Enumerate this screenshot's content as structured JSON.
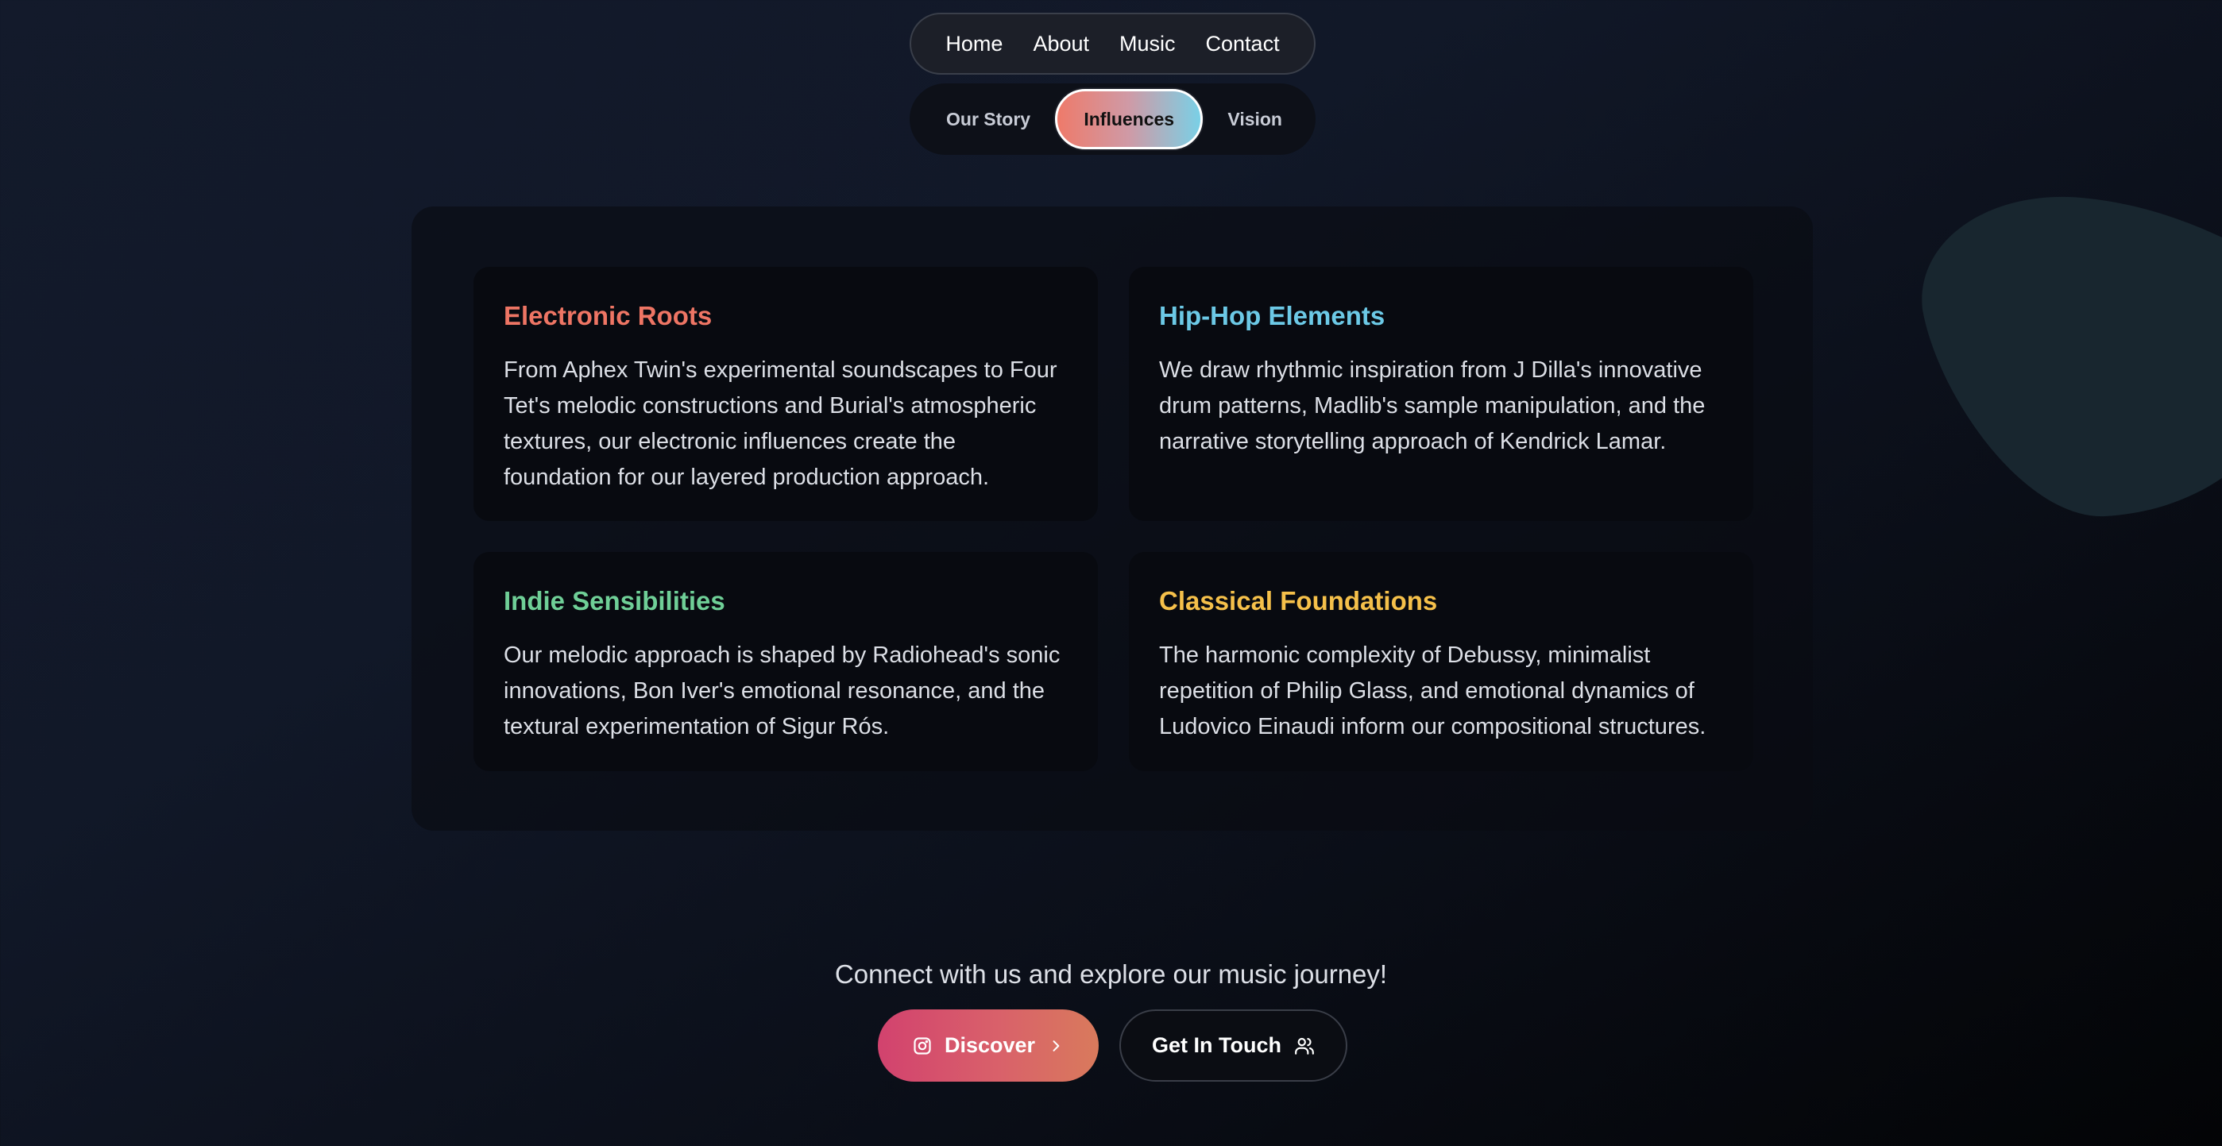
{
  "nav": {
    "links": [
      "Home",
      "About",
      "Music",
      "Contact"
    ]
  },
  "subnav": {
    "tabs": [
      "Our Story",
      "Influences",
      "Vision"
    ],
    "active": "Influences"
  },
  "influences": [
    {
      "title": "Electronic Roots",
      "color": "#ee7564",
      "text": "From Aphex Twin's experimental soundscapes to Four Tet's melodic constructions and Burial's atmospheric textures, our electronic influences create the foundation for our layered production approach."
    },
    {
      "title": "Hip-Hop Elements",
      "color": "#6cc9e6",
      "text": "We draw rhythmic inspiration from J Dilla's innovative drum patterns, Madlib's sample manipulation, and the narrative storytelling approach of Kendrick Lamar."
    },
    {
      "title": "Indie Sensibilities",
      "color": "#6fcf97",
      "text": "Our melodic approach is shaped by Radiohead's sonic innovations, Bon Iver's emotional resonance, and the textural experimentation of Sigur Rós."
    },
    {
      "title": "Classical Foundations",
      "color": "#f5c04a",
      "text": "The harmonic complexity of Debussy, minimalist repetition of Philip Glass, and emotional dynamics of Ludovico Einaudi inform our compositional structures."
    }
  ],
  "cta": {
    "tagline": "Connect with us and explore our music journey!",
    "discover_label": "Discover",
    "contact_label": "Get In Touch"
  },
  "icons": {
    "discover_leading": "instagram-icon",
    "discover_trailing": "chevron-right-icon",
    "contact_trailing": "users-icon"
  },
  "colors": {
    "background": "#111828",
    "discover_gradient_start": "#d2426e",
    "discover_gradient_end": "#d97a5c",
    "active_tab_gradient_start": "#ee7a6a",
    "active_tab_gradient_end": "#7ad0e6"
  }
}
